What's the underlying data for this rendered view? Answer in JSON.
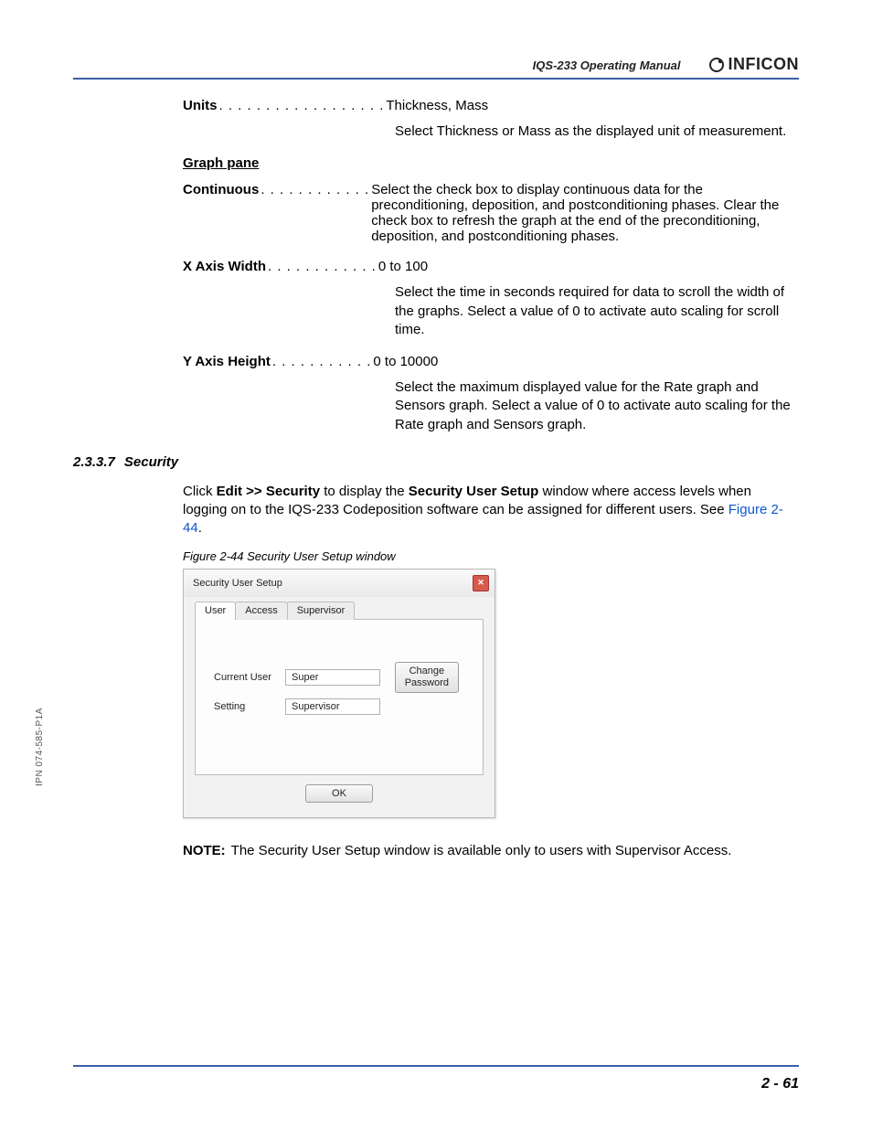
{
  "header": {
    "doc_title": "IQS-233 Operating Manual",
    "logo_text": "INFICON"
  },
  "defs": {
    "units": {
      "term": "Units",
      "dots": ". . . . . . . . . . . . . . . . . .",
      "val": "Thickness, Mass",
      "desc": "Select Thickness or Mass as the displayed unit of measurement."
    },
    "graph_pane": "Graph pane",
    "continuous": {
      "term": "Continuous",
      "dots": "  . . . . . . . . . . . .",
      "desc": "Select the check box to display continuous data for the preconditioning, deposition, and postconditioning phases. Clear the check box to refresh the graph at the end of the preconditioning, deposition, and postconditioning phases."
    },
    "xaxis": {
      "term": "X Axis Width",
      "dots": " . . . . . . . . . . . .",
      "val": "0 to 100",
      "desc": "Select the time in seconds required for data to scroll the width of the graphs. Select a value of 0 to activate auto scaling for scroll time."
    },
    "yaxis": {
      "term": "Y Axis Height",
      "dots": "  . . . . . . . . . . .",
      "val": "0 to 10000",
      "desc": "Select the maximum displayed value for the Rate graph and Sensors graph. Select a value of 0 to activate auto scaling for the Rate graph and Sensors graph."
    }
  },
  "section": {
    "num": "2.3.3.7",
    "title": "Security"
  },
  "para": {
    "p1a": "Click ",
    "p1b": "Edit >> Security",
    "p1c": " to display the ",
    "p1d": "Security User Setup",
    "p1e": " window where access levels when logging on to the IQS-233 Codeposition software can be assigned for different users. See ",
    "p1f": "Figure 2-44",
    "p1g": "."
  },
  "figure": {
    "caption": "Figure 2-44  Security User Setup window",
    "title": "Security User Setup",
    "tabs": {
      "user": "User",
      "access": "Access",
      "supervisor": "Supervisor"
    },
    "current_user_label": "Current User",
    "current_user_value": "Super",
    "setting_label": "Setting",
    "setting_value": "Supervisor",
    "change_password_btn": "Change\nPassword",
    "ok_btn": "OK"
  },
  "note": {
    "label": "NOTE:",
    "text": "The Security User Setup window is available only to users with Supervisor Access."
  },
  "side_label": "IPN 074-585-P1A",
  "footer": {
    "page": "2 - 61"
  }
}
